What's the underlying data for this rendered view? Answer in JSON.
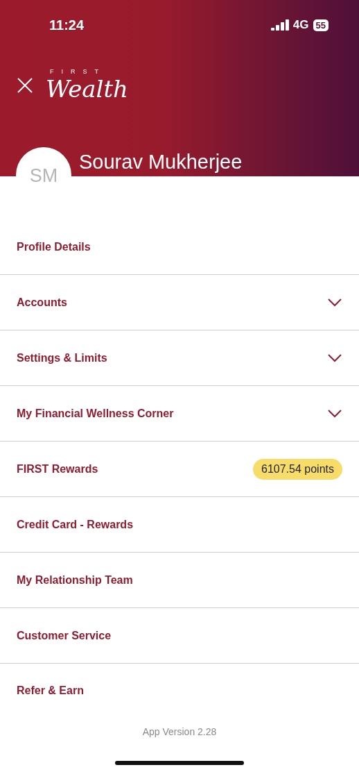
{
  "status_bar": {
    "time": "11:24",
    "network": "4G",
    "battery": "55"
  },
  "header": {
    "logo_top": "FIRST",
    "logo_main": "Wealth",
    "avatar": "SM",
    "user_name": "Sourav Mukherjee"
  },
  "menu": [
    {
      "label": "Profile Details",
      "kind": "link"
    },
    {
      "label": "Accounts",
      "kind": "expandable",
      "expanded": false
    },
    {
      "label": "Settings & Limits",
      "kind": "expandable",
      "expanded": false
    },
    {
      "label": "My Financial Wellness Corner",
      "kind": "expandable",
      "expanded": false
    },
    {
      "label": "FIRST Rewards",
      "kind": "badge",
      "badge": "6107.54 points"
    },
    {
      "label": "Credit Card - Rewards",
      "kind": "link"
    },
    {
      "label": "My Relationship Team",
      "kind": "link"
    },
    {
      "label": "Customer Service",
      "kind": "link"
    },
    {
      "label": "Refer & Earn",
      "kind": "link"
    }
  ],
  "footer": {
    "version": "App Version 2.28"
  }
}
